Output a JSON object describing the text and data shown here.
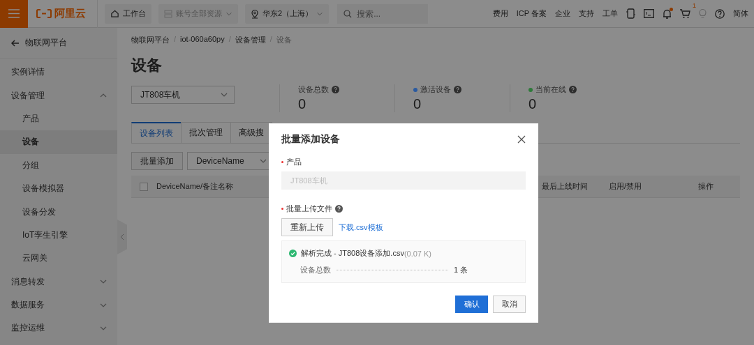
{
  "topbar": {
    "logo": "阿里云",
    "nav": [
      {
        "kind": "home",
        "label": "工作台",
        "disabled": false
      },
      {
        "kind": "resources",
        "label": "账号全部资源",
        "disabled": true
      },
      {
        "kind": "region",
        "label": "华东2（上海）",
        "disabled": false
      }
    ],
    "search": {
      "placeholder": "搜索..."
    },
    "links": [
      "费用",
      "ICP 备案",
      "企业",
      "支持",
      "工单"
    ],
    "bell": {
      "notify": true
    },
    "cart": {
      "badge": "1"
    },
    "language": "简体"
  },
  "sidebar": {
    "back": "物联网平台",
    "items": [
      {
        "label": "实例详情",
        "selected": false
      },
      {
        "label": "设备管理",
        "expanded": true,
        "selected": false,
        "children": [
          {
            "label": "产品",
            "selected": false
          },
          {
            "label": "设备",
            "selected": true
          },
          {
            "label": "分组",
            "selected": false
          },
          {
            "label": "设备模拟器",
            "selected": false
          },
          {
            "label": "设备分发",
            "selected": false
          },
          {
            "label": "IoT孪生引擎",
            "selected": false
          },
          {
            "label": "云网关",
            "selected": false
          }
        ]
      },
      {
        "label": "消息转发",
        "expanded": false,
        "selected": false
      },
      {
        "label": "数据服务",
        "expanded": false,
        "selected": false
      },
      {
        "label": "监控运维",
        "expanded": false,
        "selected": false
      }
    ]
  },
  "breadcrumb": [
    {
      "label": "物联网平台"
    },
    {
      "separator": "/",
      "label": "iot-060a60py"
    },
    {
      "separator": "/",
      "label": "设备管理"
    },
    {
      "separator": "/",
      "label": "设备"
    }
  ],
  "page_title": "设备",
  "product_select": {
    "value": "JT808车机"
  },
  "stats": [
    {
      "label": "设备总数",
      "value": "0"
    },
    {
      "label": "激活设备",
      "value": "0",
      "color": "#2a5aa0"
    },
    {
      "label": "当前在线",
      "value": "0",
      "color": "#2e7a3a"
    }
  ],
  "tabs": [
    {
      "label": "设备列表",
      "selected": true
    },
    {
      "label": "批次管理",
      "selected": false
    },
    {
      "label": "高级搜",
      "selected": false
    }
  ],
  "toolbar": {
    "button": "批量添加",
    "filter": "DeviceName"
  },
  "table": {
    "select_all": {
      "checked": false
    },
    "columns": [
      "DeviceName/备注名称",
      "最后上线时间",
      "启用/禁用",
      "操作"
    ]
  },
  "dialog": {
    "title": "批量添加设备",
    "product": {
      "label": "产品",
      "required": true,
      "value": "JT808车机",
      "disabled": true
    },
    "upload": {
      "label": "批量上传文件",
      "required": true,
      "button": "重新上传",
      "link": "下载.csv模板"
    },
    "result": {
      "status": "解析完成 - JT808设备添加.csv",
      "size": "(0.07 K)",
      "count_label": "设备总数",
      "count": "1 条"
    },
    "buttons": [
      {
        "kind": "primary",
        "label": "确认"
      },
      {
        "kind": "default",
        "label": "取消"
      }
    ]
  }
}
